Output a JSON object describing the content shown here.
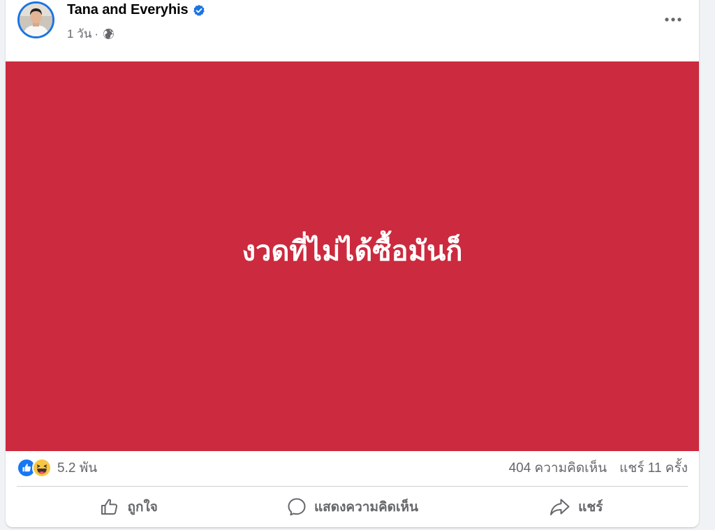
{
  "post": {
    "author": "Tana and Everyhis",
    "verified": true,
    "time": "1 วัน",
    "separator": "·",
    "audience_icon": "globe-icon",
    "more_icon": "more-options-icon",
    "image_text": "งวดที่ไม่ได้ซื้อมันก็",
    "image_background": "#cc2a3e"
  },
  "stats": {
    "reaction_icons": [
      "like-reaction-icon",
      "haha-reaction-icon"
    ],
    "reaction_count": "5.2 พัน",
    "comments": "404 ความคิดเห็น",
    "shares": "แชร์ 11 ครั้ง"
  },
  "actions": {
    "like": "ถูกใจ",
    "comment": "แสดงความคิดเห็น",
    "share": "แชร์"
  },
  "colors": {
    "accent": "#1b74e4",
    "secondary_text": "#65676b"
  }
}
